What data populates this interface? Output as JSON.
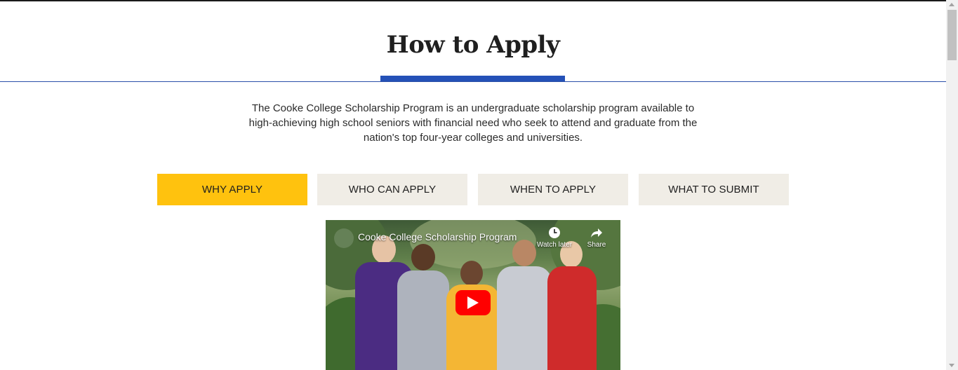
{
  "page": {
    "title": "How to Apply",
    "intro": "The Cooke College Scholarship Program is an undergraduate scholarship program available to high-achieving high school seniors with financial need who seek to attend and graduate from the nation's top four-year colleges and universities."
  },
  "tabs": [
    {
      "label": "WHY APPLY",
      "active": true
    },
    {
      "label": "WHO CAN APPLY",
      "active": false
    },
    {
      "label": "WHEN TO APPLY",
      "active": false
    },
    {
      "label": "WHAT TO SUBMIT",
      "active": false
    }
  ],
  "video": {
    "title": "Cooke College Scholarship Program",
    "watch_later_label": "Watch later",
    "share_label": "Share",
    "play_icon": "play-icon"
  },
  "colors": {
    "accent_blue": "#2451b7",
    "active_tab": "#ffc20e",
    "inactive_tab": "#f0ede6",
    "youtube_red": "#ff0000"
  }
}
